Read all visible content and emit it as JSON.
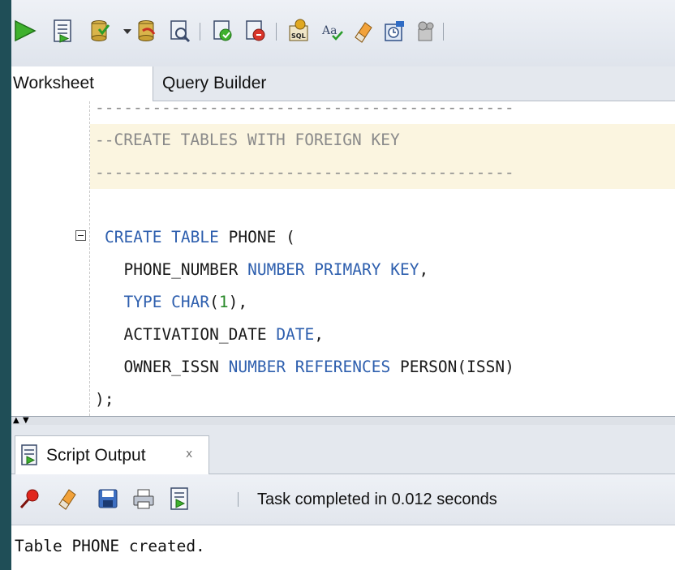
{
  "toolbar": {
    "icons": [
      "run-statement-icon",
      "run-script-icon",
      "commit-icon",
      "dropdown-arrow-icon",
      "rollback-icon",
      "explain-plan-icon",
      "autotrace-icon",
      "sql-tuning-icon",
      "sql-history-icon",
      "format-icon",
      "clear-icon",
      "sql-monitor-icon",
      "unshared-worksheet-icon"
    ]
  },
  "tabs": {
    "worksheet": "Worksheet",
    "query_builder": "Query Builder"
  },
  "editor": {
    "lines": [
      {
        "comment": "--------------------------------------------"
      },
      {
        "comment": "--CREATE TABLES WITH FOREIGN KEY"
      },
      {
        "comment": "--------------------------------------------"
      },
      {
        "kw1": "CREATE TABLE",
        "rest": " PHONE ("
      },
      {
        "pre": "  PHONE_NUMBER ",
        "kw": "NUMBER PRIMARY KEY",
        "post": ","
      },
      {
        "pre": "  ",
        "kw": "TYPE CHAR",
        "paren_open": "(",
        "num": "1",
        "paren_close": "),"
      },
      {
        "pre": "  ACTIVATION_DATE ",
        "kw": "DATE",
        "post": ","
      },
      {
        "pre": "  OWNER_ISSN ",
        "kw": "NUMBER REFERENCES",
        "post": " PERSON(ISSN)"
      },
      {
        "text": ");"
      }
    ]
  },
  "output": {
    "tab_label": "Script Output",
    "tab_close": "x",
    "toolbar_icons": [
      "pin-icon",
      "clear-icon",
      "save-icon",
      "print-icon",
      "open-file-icon"
    ],
    "status": "Task completed in 0.012 seconds",
    "text": "Table PHONE created."
  },
  "colors": {
    "keyword": "#2e5fae",
    "comment": "#8a8a8a",
    "number": "#2a8a2a",
    "highlight": "#fbf5e0",
    "frame": "#1f4e57"
  }
}
